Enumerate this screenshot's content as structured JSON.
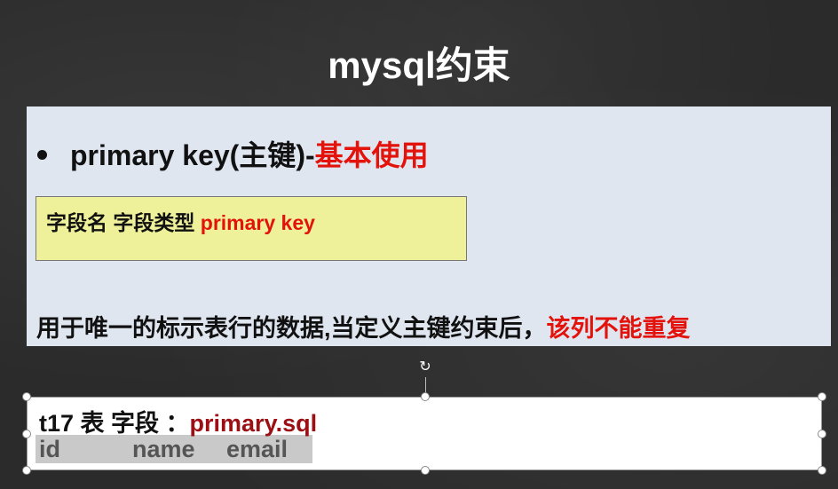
{
  "slide": {
    "title": "mysql约束",
    "bullet": {
      "prefix": "primary key(主键)-",
      "highlight": "基本使用"
    },
    "syntax": {
      "text": "字段名 字段类型 ",
      "keyword": "primary key"
    },
    "description": {
      "text": "用于唯一的标示表行的数据,当定义主键约束后，",
      "highlight": "该列不能重复"
    }
  },
  "textbox": {
    "label": "t17 表 字段 ：",
    "filename": "primary.sql",
    "columns": [
      "id",
      "name",
      "email"
    ]
  },
  "colors": {
    "background": "#2b2b2b",
    "panel": "#dfe6f0",
    "syntax_box": "#eef19a",
    "highlight_red": "#e3120b",
    "filename_red": "#9c0f14",
    "column_strip": "#c9c9c9"
  },
  "icons": {
    "rotate": "rotate-handle-icon",
    "bullet": "bullet-dot-icon"
  }
}
